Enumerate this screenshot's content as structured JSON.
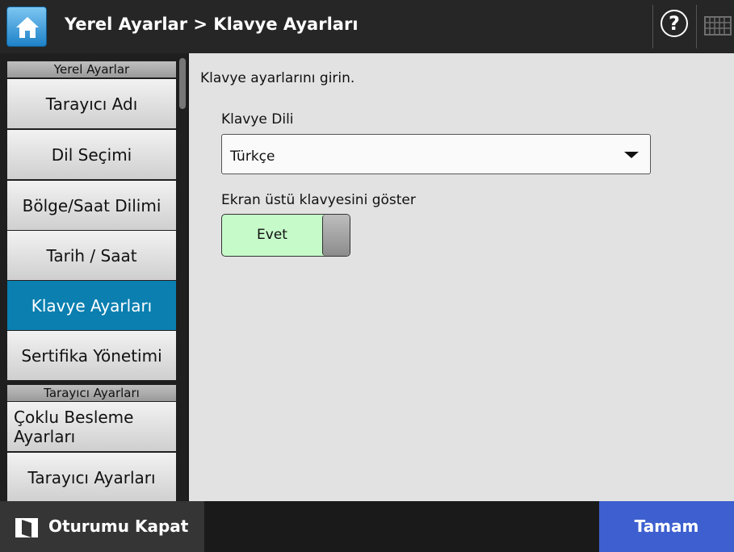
{
  "header": {
    "title": "Yerel Ayarlar > Klavye Ayarları",
    "help_symbol": "?",
    "home_icon": "home-icon",
    "keyboard_icon": "keyboard-icon"
  },
  "sidebar": {
    "sections": [
      {
        "label": "Yerel Ayarlar"
      },
      {
        "label": "Tarayıcı Ayarları"
      }
    ],
    "items": [
      {
        "label": "Tarayıcı Adı"
      },
      {
        "label": "Dil Seçimi"
      },
      {
        "label": "Bölge/Saat Dilimi"
      },
      {
        "label": "Tarih / Saat"
      },
      {
        "label": "Klavye Ayarları",
        "active": true
      },
      {
        "label": "Sertifika Yönetimi"
      },
      {
        "label": "Çoklu Besleme Ayarları"
      },
      {
        "label": "Tarayıcı Ayarları"
      }
    ]
  },
  "main": {
    "intro": "Klavye ayarlarını girin.",
    "language_label": "Klavye Dili",
    "language_value": "Türkçe",
    "onscreen_label": "Ekran üstü klavyesini göster",
    "onscreen_value": "Evet"
  },
  "footer": {
    "logout_label": "Oturumu Kapat",
    "ok_label": "Tamam"
  },
  "colors": {
    "active_item": "#0a7fb0",
    "ok_button": "#3d5fcf",
    "toggle_on": "#c6fbc9",
    "home_button": "#1e82c8"
  }
}
